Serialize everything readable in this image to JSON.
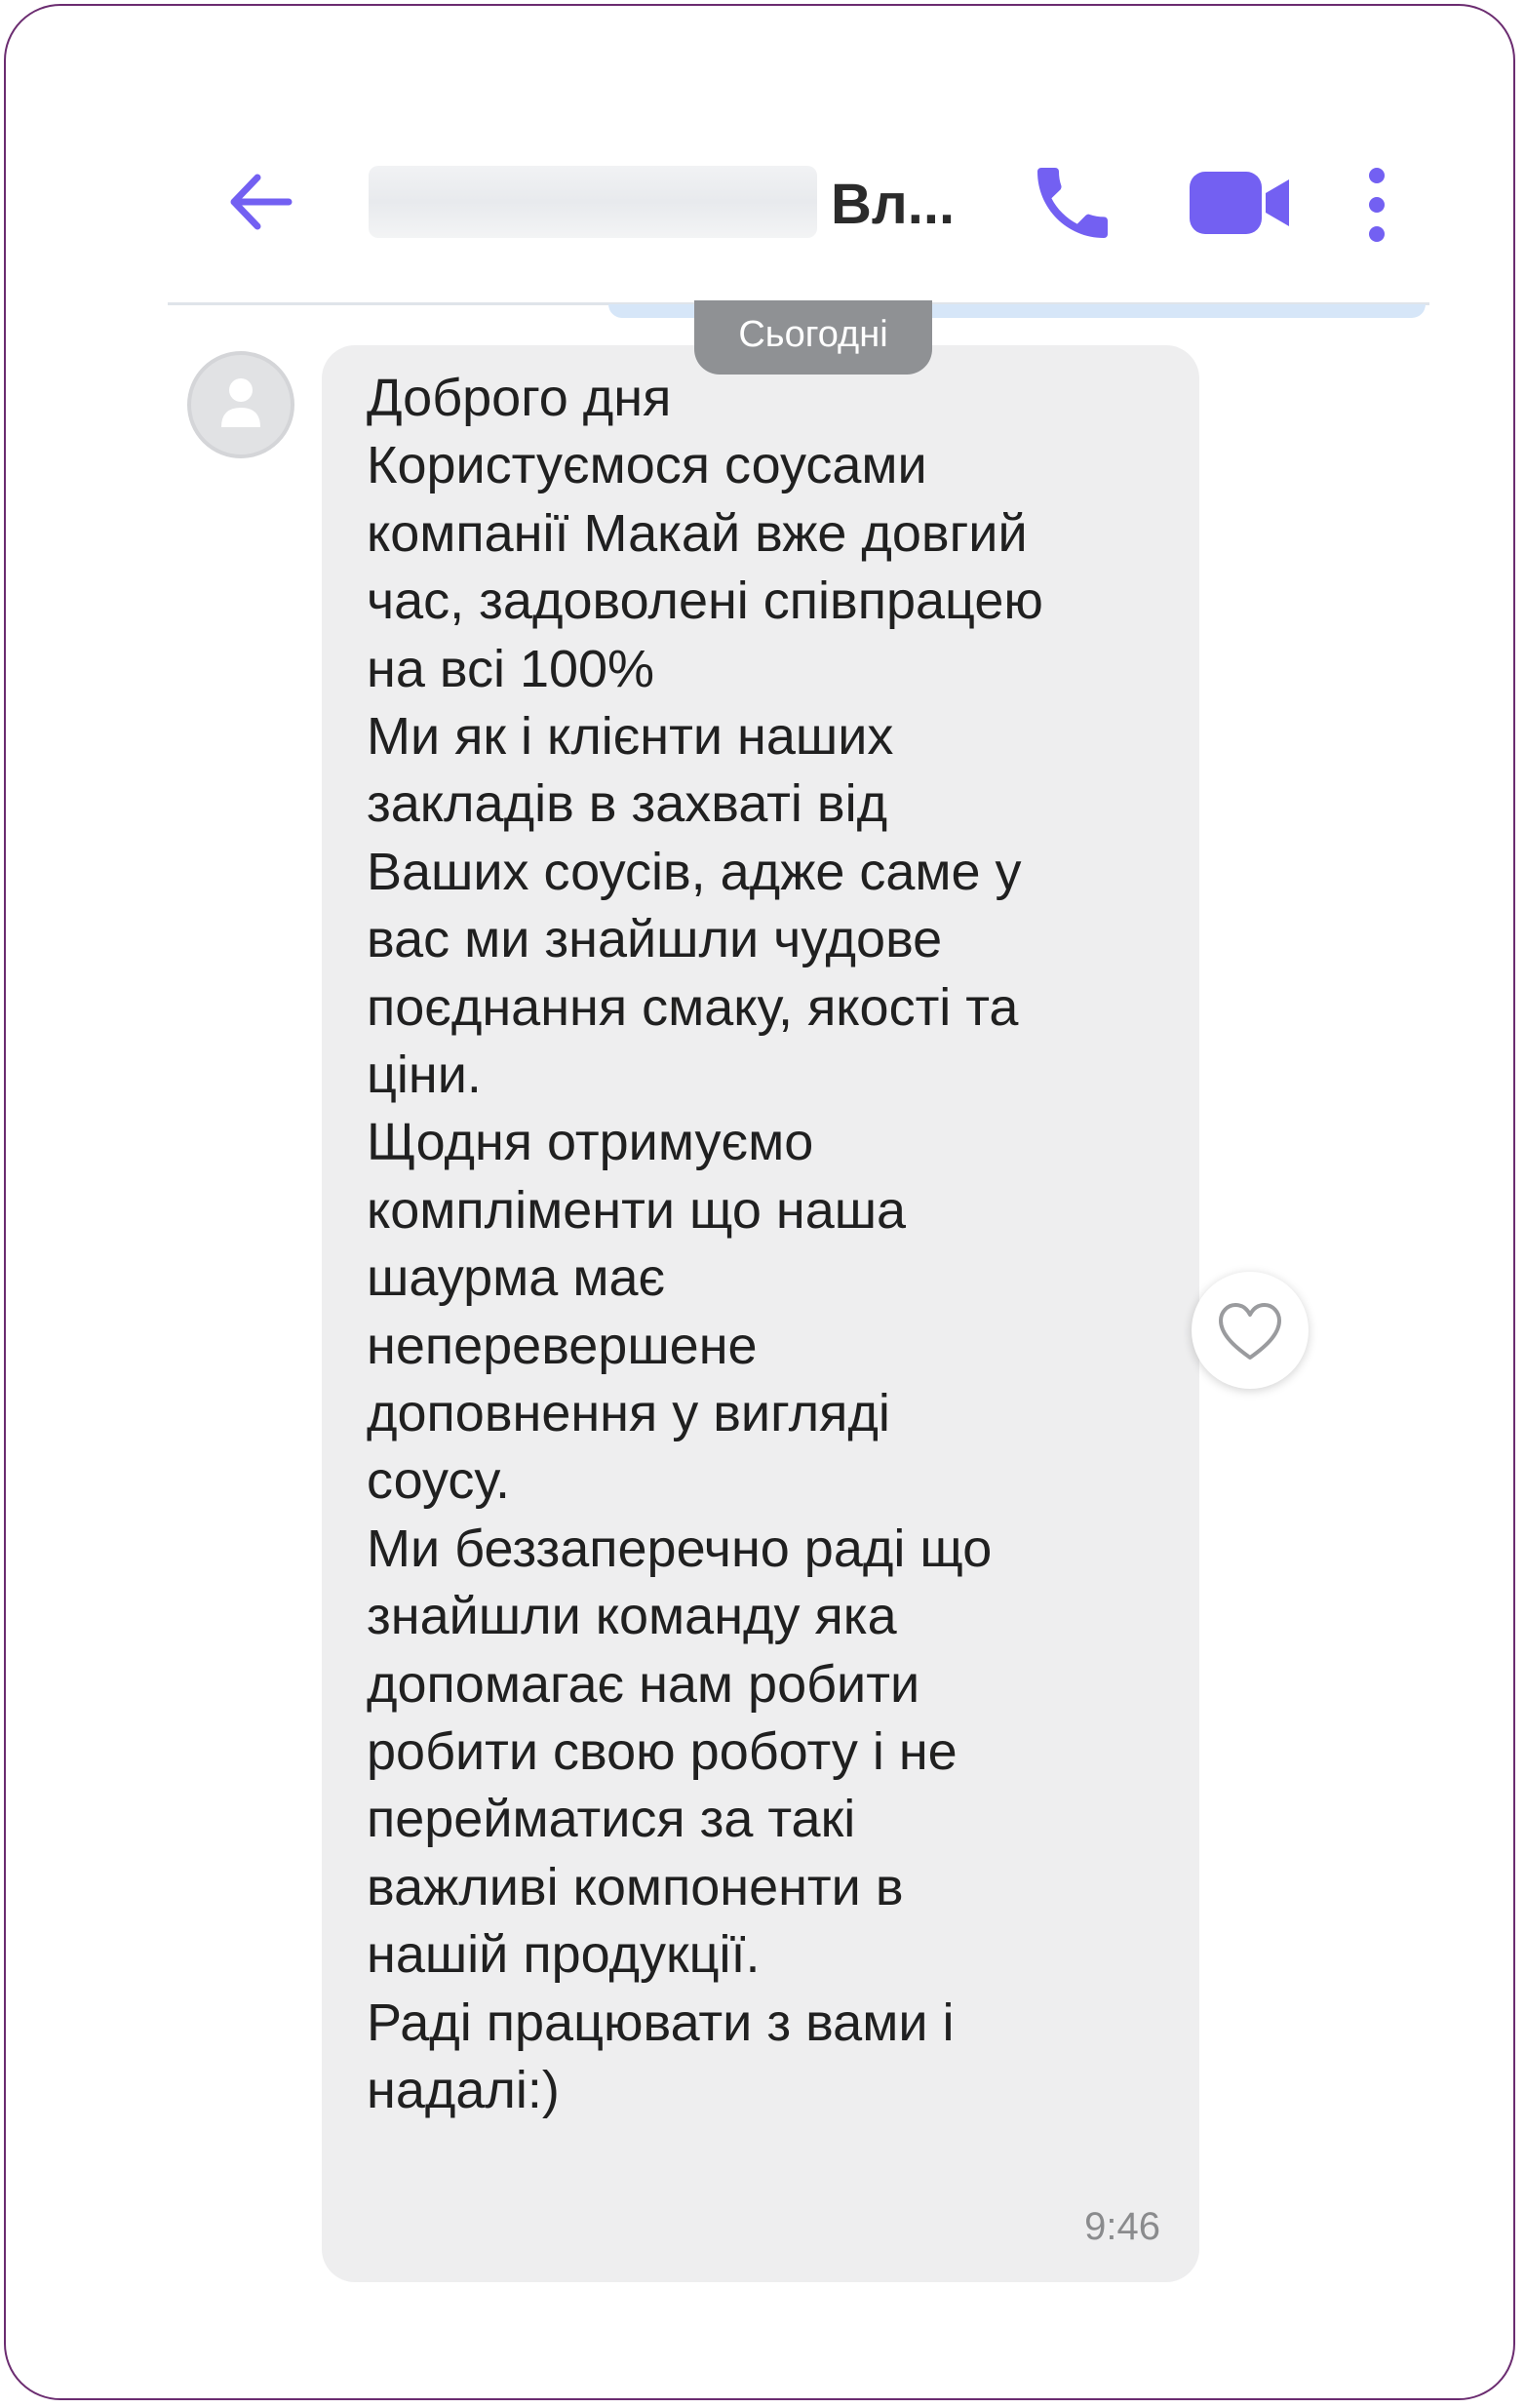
{
  "header": {
    "contact_name_visible": "Вл...",
    "back_icon": "back-arrow-icon",
    "call_icon": "phone-icon",
    "video_icon": "video-camera-icon",
    "more_icon": "more-vertical-icon"
  },
  "chat": {
    "date_separator": "Сьогодні",
    "message": {
      "lines": [
        "Доброго дня",
        "Користуємося соусами",
        "компанії Макай вже довгий",
        "час, задоволені співпрацею",
        "на всі 100%",
        "Ми як і клієнти наших",
        "закладів в захваті від",
        "Ваших соусів, адже саме у",
        "вас ми знайшли чудове",
        "поєднання смаку, якості та",
        "ціни.",
        "Щодня отримуємо",
        "компліменти що наша",
        "шаурма має",
        "неперевершене",
        "доповнення у вигляді",
        "соусу.",
        "Ми беззаперечно раді що",
        "знайшли команду яка",
        "допомагає нам робити",
        "робити свою роботу і не",
        "перейматися за такі",
        "важливі компоненти в",
        "нашій продукції.",
        "Раді працювати з вами і",
        "надалі:)"
      ],
      "time": "9:46"
    },
    "like_icon": "heart-outline-icon",
    "avatar_icon": "person-icon"
  },
  "colors": {
    "accent": "#7360f2",
    "bubble": "#eeeeef",
    "frame": "#6b2c70"
  }
}
